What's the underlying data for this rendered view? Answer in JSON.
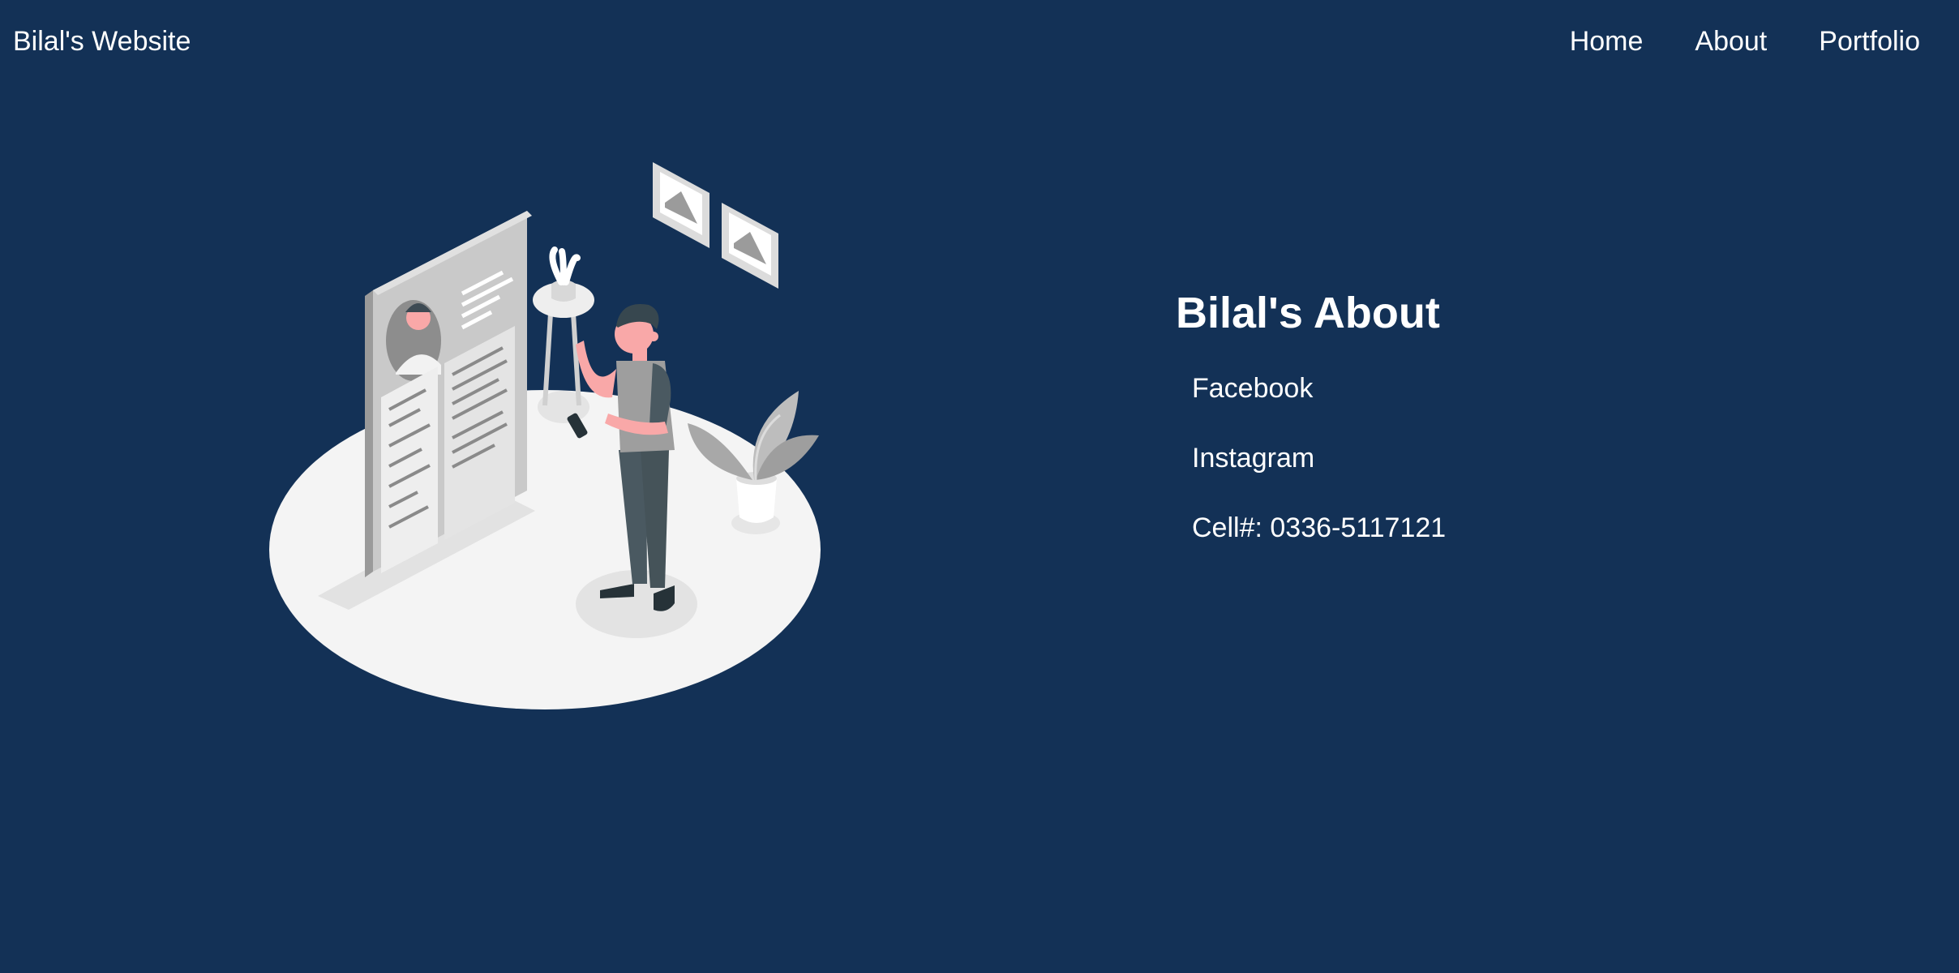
{
  "header": {
    "brand": "Bilal's Website",
    "nav": [
      "Home",
      "About",
      "Portfolio"
    ]
  },
  "about": {
    "title": "Bilal's About",
    "links": [
      "Facebook",
      "Instagram"
    ],
    "contact": "Cell#: 0336-5117121"
  },
  "illustration": {
    "icon": "resume-person-illustration-icon"
  },
  "colors": {
    "background": "#133156",
    "text": "#ffffff"
  }
}
